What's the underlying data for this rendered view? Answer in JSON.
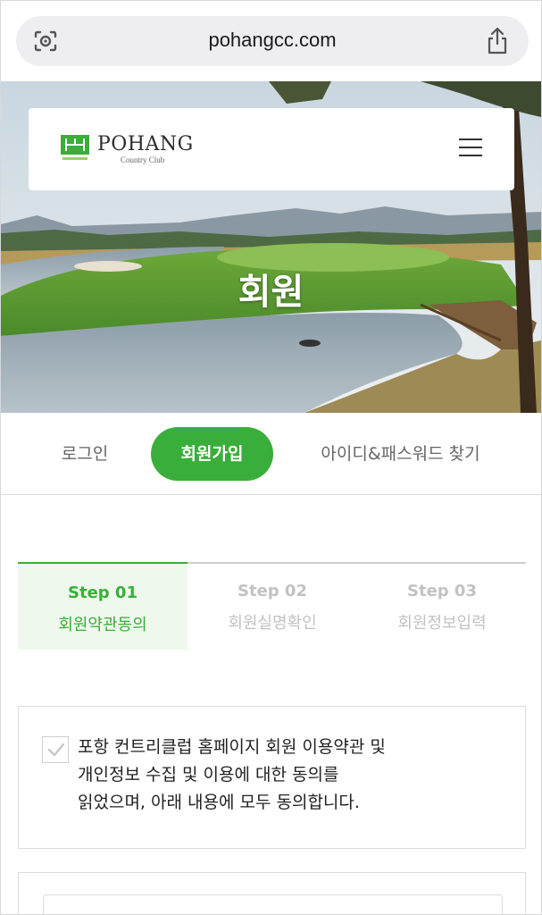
{
  "browser": {
    "url": "pohangcc.com",
    "icons": {
      "left": "lens-icon",
      "right": "share-icon"
    }
  },
  "header": {
    "logo_word": "POHANG",
    "logo_sub": "Country Club",
    "menu_icon": "hamburger-menu-icon"
  },
  "hero": {
    "title": "회원"
  },
  "auth_tabs": [
    {
      "label": "로그인",
      "active": false
    },
    {
      "label": "회원가입",
      "active": true
    },
    {
      "label": "아이디&패스워드 찾기",
      "active": false
    }
  ],
  "steps": [
    {
      "num": "Step 01",
      "label": "회원약관동의",
      "active": true
    },
    {
      "num": "Step 02",
      "label": "회원실명확인",
      "active": false
    },
    {
      "num": "Step 03",
      "label": "회원정보입력",
      "active": false
    }
  ],
  "agreement": {
    "line1": "포항 컨트리클럽 홈페이지 회원 이용약관 및",
    "line2": "개인정보 수집 및 이용에 대한 동의를",
    "line3": "읽었으며, 아래 내용에 모두 동의합니다."
  },
  "colors": {
    "accent": "#3aae3a",
    "accent_light": "#eef8ec",
    "muted": "#c2c2c2"
  }
}
